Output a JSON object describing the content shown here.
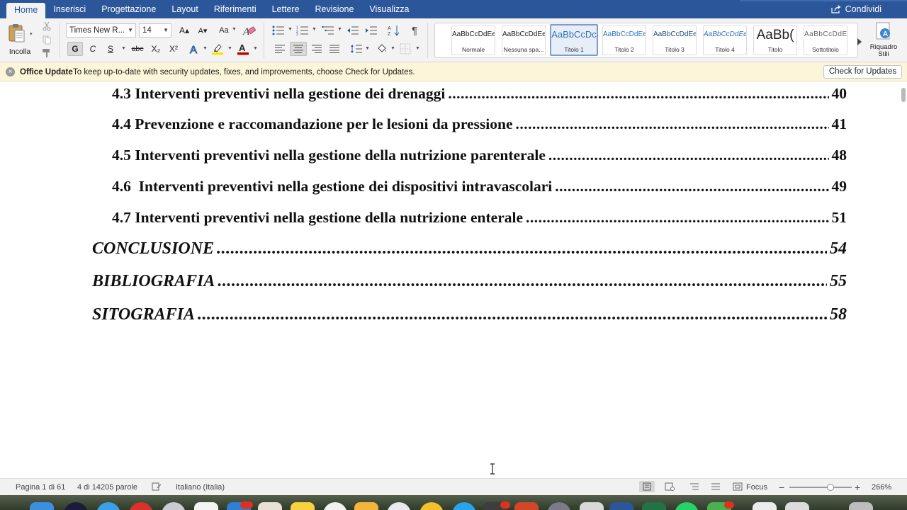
{
  "ribbon": {
    "tabs": [
      {
        "label": "Home",
        "active": true
      },
      {
        "label": "Inserisci"
      },
      {
        "label": "Progettazione"
      },
      {
        "label": "Layout"
      },
      {
        "label": "Riferimenti"
      },
      {
        "label": "Lettere"
      },
      {
        "label": "Revisione"
      },
      {
        "label": "Visualizza"
      }
    ],
    "share_label": "Condividi",
    "paste_label": "Incolla",
    "font_name": "Times New R...",
    "font_size": "14",
    "bold_label": "G",
    "italic_label": "C",
    "underline_label": "S",
    "strike_label": "abc",
    "sub_label": "X₂",
    "sup_label": "X²",
    "grow_label": "A▴",
    "shrink_label": "A▾",
    "case_label": "Aa",
    "pilcrow_label": "¶",
    "styles": [
      {
        "sample": "AaBbCcDdEe",
        "name": "Normale"
      },
      {
        "sample": "AaBbCcDdEe",
        "name": "Nessuna spa..."
      },
      {
        "sample": "AaBbCcDc",
        "name": "Titolo 1",
        "active": true
      },
      {
        "sample": "AaBbCcDdEe",
        "name": "Titolo 2"
      },
      {
        "sample": "AaBbCcDdEe",
        "name": "Titolo 3"
      },
      {
        "sample": "AaBbCcDdEe",
        "name": "Titolo 4"
      },
      {
        "sample": "AaBb(",
        "name": "Titolo"
      },
      {
        "sample": "AaBbCcDdEe",
        "name": "Sottotitolo"
      }
    ],
    "styles_pane_label_1": "Riquadro",
    "styles_pane_label_2": "Stili"
  },
  "update_bar": {
    "title": "Office Update",
    "message": "To keep up-to-date with security updates, fixes, and improvements, choose Check for Updates.",
    "button": "Check for Updates"
  },
  "document": {
    "toc": [
      {
        "title": "4.3 Interventi preventivi nella gestione dei drenaggi",
        "page": "40",
        "level": "sub"
      },
      {
        "title": "4.4 Prevenzione e raccomandazione per le lesioni da pressione",
        "page": "41",
        "level": "sub"
      },
      {
        "title": "4.5 Interventi preventivi nella gestione della nutrizione parenterale",
        "page": "48",
        "level": "sub"
      },
      {
        "title": "4.6  Interventi preventivi nella gestione dei dispositivi intravascolari",
        "page": "49",
        "level": "sub"
      },
      {
        "title": "4.7 Interventi preventivi nella gestione della nutrizione enterale",
        "page": "51",
        "level": "sub"
      },
      {
        "title": "CONCLUSIONE",
        "page": "54",
        "level": "main"
      },
      {
        "title": "BIBLIOGRAFIA",
        "page": "55",
        "level": "main"
      },
      {
        "title": "SITOGRAFIA",
        "page": "58",
        "level": "main"
      }
    ]
  },
  "status_bar": {
    "page": "Pagina 1 di 61",
    "words": "4 di 14205 parole",
    "language": "Italiano (Italia)",
    "focus": "Focus",
    "zoom": "266%"
  },
  "colors": {
    "ribbon_blue": "#2b579a",
    "ribbon_bg": "#f3f3f3",
    "update_bg": "#fcf5d9"
  }
}
